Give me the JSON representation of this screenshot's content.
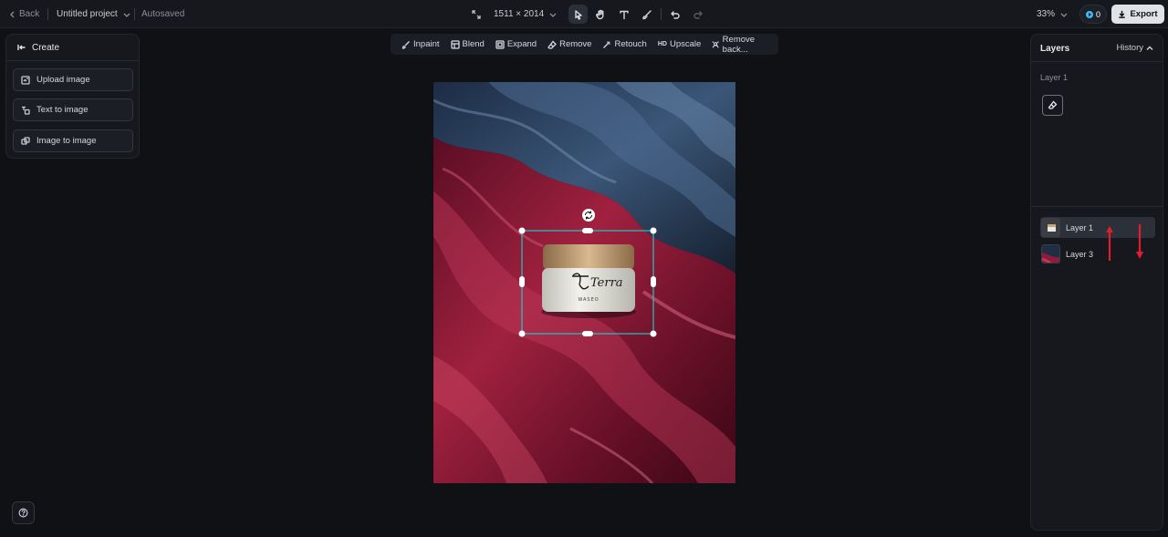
{
  "topbar": {
    "back_label": "Back",
    "project_title": "Untitled project",
    "autosave_status": "Autosaved",
    "canvas_size": "1511 × 2014",
    "zoom": "33%",
    "credits": "0",
    "export_label": "Export"
  },
  "create_panel": {
    "title": "Create",
    "buttons": [
      "Upload image",
      "Text to image",
      "Image to image"
    ]
  },
  "tools": {
    "inpaint": "Inpaint",
    "blend": "Blend",
    "expand": "Expand",
    "remove": "Remove",
    "retouch": "Retouch",
    "upscale_badge": "HD",
    "upscale": "Upscale",
    "remove_background": "Remove back..."
  },
  "layers_panel": {
    "title": "Layers",
    "history_label": "History",
    "selected_layer_label": "Layer 1",
    "layers": [
      {
        "name": "Layer 1",
        "selected": true
      },
      {
        "name": "Layer 3",
        "selected": false
      }
    ]
  },
  "canvas_image": {
    "jar_brand": "Terra",
    "jar_subtext": "WASEO"
  },
  "colors": {
    "accent_selection": "#22c5c5",
    "arrow_annotation": "#e11d2e",
    "export_bg": "#dfe3e8",
    "credit_dot": "#38bdf8"
  }
}
